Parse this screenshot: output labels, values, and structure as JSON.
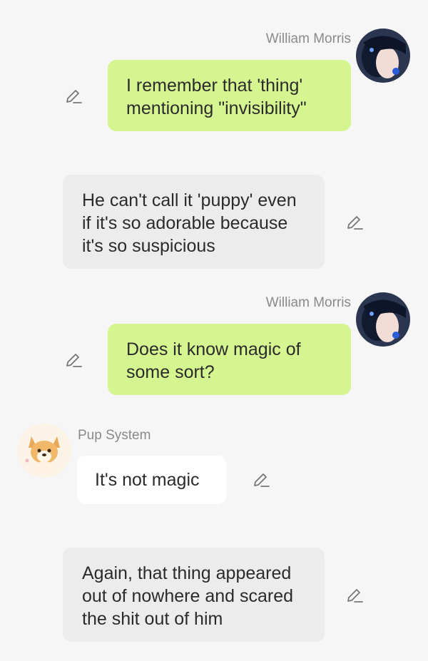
{
  "messages": [
    {
      "type": "user",
      "sender": "William Morris",
      "text": "I remember that 'thing' mentioning \"invisibility\""
    },
    {
      "type": "narration",
      "text": "He can't call it 'puppy' even if it's so adorable because it's so suspicious"
    },
    {
      "type": "user",
      "sender": "William Morris",
      "text": "Does it know magic of some sort?"
    },
    {
      "type": "bot",
      "sender": "Pup System",
      "text": "It's not magic"
    },
    {
      "type": "narration",
      "text": "Again, that thing appeared out of nowhere and scared the shit out of him"
    }
  ],
  "icons": {
    "edit": "pencil-edit-icon",
    "user_avatar": "user-avatar-anime-portrait",
    "bot_avatar": "bot-avatar-corgi-puppy"
  },
  "colors": {
    "background": "#f6f6f6",
    "user_bubble": "#d5f591",
    "narration_bubble": "#ececec",
    "bot_bubble": "#ffffff",
    "name_text": "#8a8a8a"
  }
}
